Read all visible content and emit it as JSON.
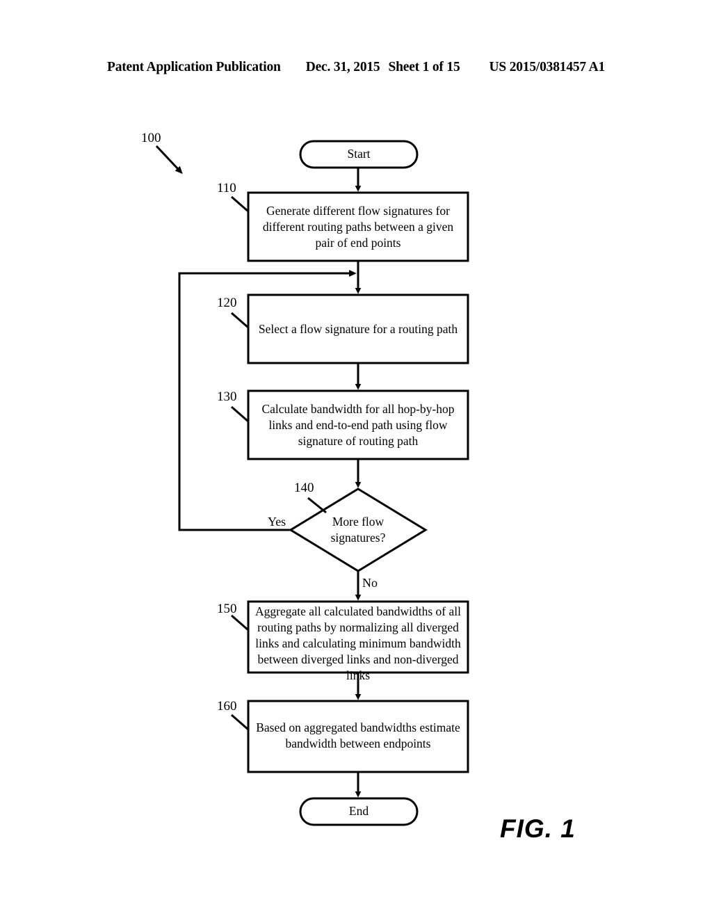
{
  "header": {
    "publication": "Patent Application Publication",
    "date": "Dec. 31, 2015",
    "sheet": "Sheet 1 of 15",
    "number": "US 2015/0381457 A1"
  },
  "figure": {
    "caption": "FIG. 1",
    "diagram_ref": "100",
    "nodes": {
      "start": {
        "ref": "",
        "label": "Start"
      },
      "step110": {
        "ref": "110",
        "label": "Generate different flow signatures for different routing paths between a given pair of end points"
      },
      "step120": {
        "ref": "120",
        "label": "Select a flow signature for a routing path"
      },
      "step130": {
        "ref": "130",
        "label": "Calculate bandwidth for all hop-by-hop links and end-to-end path using flow signature of routing path"
      },
      "decision140": {
        "ref": "140",
        "label": "More flow signatures?",
        "yes_label": "Yes",
        "no_label": "No"
      },
      "step150": {
        "ref": "150",
        "label": "Aggregate all calculated bandwidths of all routing paths by normalizing all diverged links and calculating minimum bandwidth between diverged links and non-diverged links"
      },
      "step160": {
        "ref": "160",
        "label": "Based on aggregated bandwidths estimate bandwidth between endpoints"
      },
      "end": {
        "ref": "",
        "label": "End"
      }
    },
    "colors": {
      "stroke": "#000000",
      "fill": "#ffffff"
    }
  }
}
